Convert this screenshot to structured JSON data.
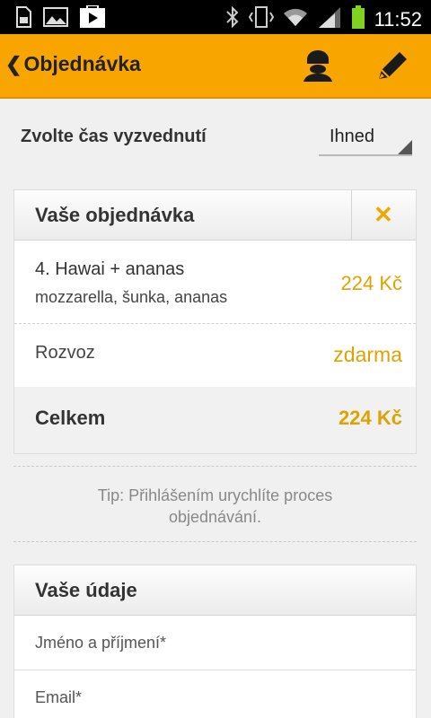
{
  "status_bar": {
    "time": "11:52",
    "icons": [
      "sd-card-icon",
      "image-icon",
      "play-store-icon",
      "bluetooth-icon",
      "vibrate-icon",
      "wifi-icon",
      "signal-icon",
      "battery-icon"
    ]
  },
  "action_bar": {
    "title": "Objednávka",
    "back_icon": "chevron-left-icon",
    "actions": [
      "user-icon",
      "edit-icon"
    ],
    "background": "#f8a500"
  },
  "pickup": {
    "label": "Zvolte čas vyzvednutí",
    "value": "Ihned"
  },
  "order": {
    "title": "Vaše objednávka",
    "close_symbol": "✕",
    "items": [
      {
        "name": "4. Hawai  + ananas",
        "description": "mozzarella, šunka, ananas",
        "price": "224 Kč"
      }
    ],
    "delivery": {
      "label": "Rozvoz",
      "value": "zdarma"
    },
    "total": {
      "label": "Celkem",
      "value": "224 Kč"
    },
    "accent": "#dfa200"
  },
  "tip": {
    "line1": "Tip: Přihlášením urychlíte proces",
    "line2": "objednávání."
  },
  "details": {
    "title": "Vaše údaje",
    "fields": [
      {
        "label": "Jméno a příjmení*"
      },
      {
        "label": "Email*"
      }
    ]
  }
}
